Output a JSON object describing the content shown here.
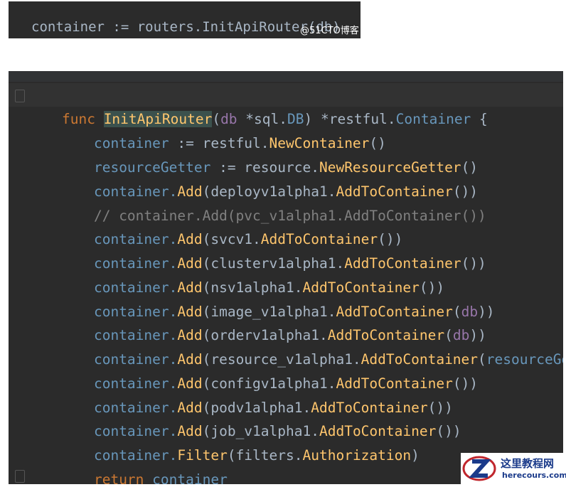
{
  "snippet": {
    "text": "container := routers.InitApiRouter(db)",
    "watermark": "@51CTO博客"
  },
  "editor": {
    "sig": {
      "func_kw": "func",
      "name": "InitApiRouter",
      "p_open": "(",
      "param": "db",
      "ptype1": "*sql.",
      "ptype2": "DB",
      "p_close": ") ",
      "ret1": "*restful.",
      "ret2": "Container",
      "brace": " {"
    },
    "l1": {
      "a": "container",
      "b": " := restful.",
      "c": "NewContainer",
      "d": "()"
    },
    "l2": {
      "a": "resourceGetter",
      "b": " := resource.",
      "c": "NewResourceGetter",
      "d": "()"
    },
    "l3": {
      "a": "container.",
      "b": "Add",
      "c": "(deployv1alpha1.",
      "d": "AddToContainer",
      "e": "())"
    },
    "l4": {
      "comment": "// container.Add(pvc_v1alpha1.AddToContainer())"
    },
    "l5": {
      "a": "container.",
      "b": "Add",
      "c": "(svcv1.",
      "d": "AddToContainer",
      "e": "())"
    },
    "l6": {
      "a": "container.",
      "b": "Add",
      "c": "(clusterv1alpha1.",
      "d": "AddToContainer",
      "e": "())"
    },
    "l7": {
      "a": "container.",
      "b": "Add",
      "c": "(nsv1alpha1.",
      "d": "AddToContainer",
      "e": "())"
    },
    "l8": {
      "a": "container.",
      "b": "Add",
      "c": "(image_v1alpha1.",
      "d": "AddToContainer",
      "e": "(",
      "f": "db",
      "g": "))"
    },
    "l9": {
      "a": "container.",
      "b": "Add",
      "c": "(orderv1alpha1.",
      "d": "AddToContainer",
      "e": "(",
      "f": "db",
      "g": "))"
    },
    "l10": {
      "a": "container.",
      "b": "Add",
      "c": "(resource_v1alpha1.",
      "d": "AddToContainer",
      "e": "(",
      "f": "resourceGetter",
      "g": "))"
    },
    "l11": {
      "a": "container.",
      "b": "Add",
      "c": "(configv1alpha1.",
      "d": "AddToContainer",
      "e": "())"
    },
    "l12": {
      "a": "container.",
      "b": "Add",
      "c": "(podv1alpha1.",
      "d": "AddToContainer",
      "e": "())"
    },
    "l13": {
      "a": "container.",
      "b": "Add",
      "c": "(job_v1alpha1.",
      "d": "AddToContainer",
      "e": "())"
    },
    "l14": {
      "a": "container.",
      "b": "Filter",
      "c": "(filters.",
      "d": "Authorization",
      "e": ")"
    },
    "l15": {
      "kw": "return",
      "v": " container"
    },
    "close": "}"
  },
  "logo": {
    "text": "这里教程网",
    "sub": "herecours.com",
    "colors": {
      "brand": "#1a3a8a",
      "accent": "#c0262d"
    }
  }
}
